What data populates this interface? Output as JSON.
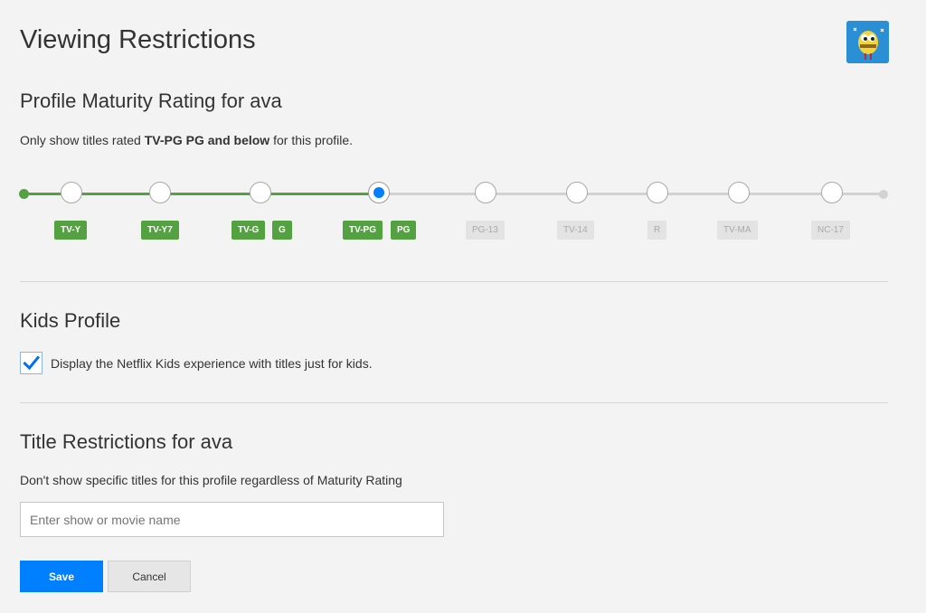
{
  "page": {
    "title": "Viewing Restrictions"
  },
  "maturity": {
    "heading": "Profile Maturity Rating for ava",
    "desc_prefix": "Only show titles rated ",
    "desc_bold": "TV-PG PG and below",
    "desc_suffix": " for this profile.",
    "selected_level": "TV-PG PG",
    "levels": [
      {
        "badges": [
          "TV-Y"
        ],
        "enabled": true
      },
      {
        "badges": [
          "TV-Y7"
        ],
        "enabled": true
      },
      {
        "badges": [
          "TV-G",
          "G"
        ],
        "enabled": true
      },
      {
        "badges": [
          "TV-PG",
          "PG"
        ],
        "enabled": true
      },
      {
        "badges": [
          "PG-13"
        ],
        "enabled": false
      },
      {
        "badges": [
          "TV-14"
        ],
        "enabled": false
      },
      {
        "badges": [
          "R"
        ],
        "enabled": false
      },
      {
        "badges": [
          "TV-MA"
        ],
        "enabled": false
      },
      {
        "badges": [
          "NC-17"
        ],
        "enabled": false
      }
    ]
  },
  "kids": {
    "heading": "Kids Profile",
    "checkbox_label": "Display the Netflix Kids experience with titles just for kids.",
    "checked": true
  },
  "titles": {
    "heading": "Title Restrictions for ava",
    "desc": "Don't show specific titles for this profile regardless of Maturity Rating",
    "search_placeholder": "Enter show or movie name",
    "search_value": ""
  },
  "buttons": {
    "save": "Save",
    "cancel": "Cancel"
  },
  "colors": {
    "green": "#54a141",
    "blue": "#0080ff",
    "gray_track": "#d2d2d2"
  },
  "icons": {
    "avatar": "avatar-icon",
    "check": "checkmark-icon"
  }
}
